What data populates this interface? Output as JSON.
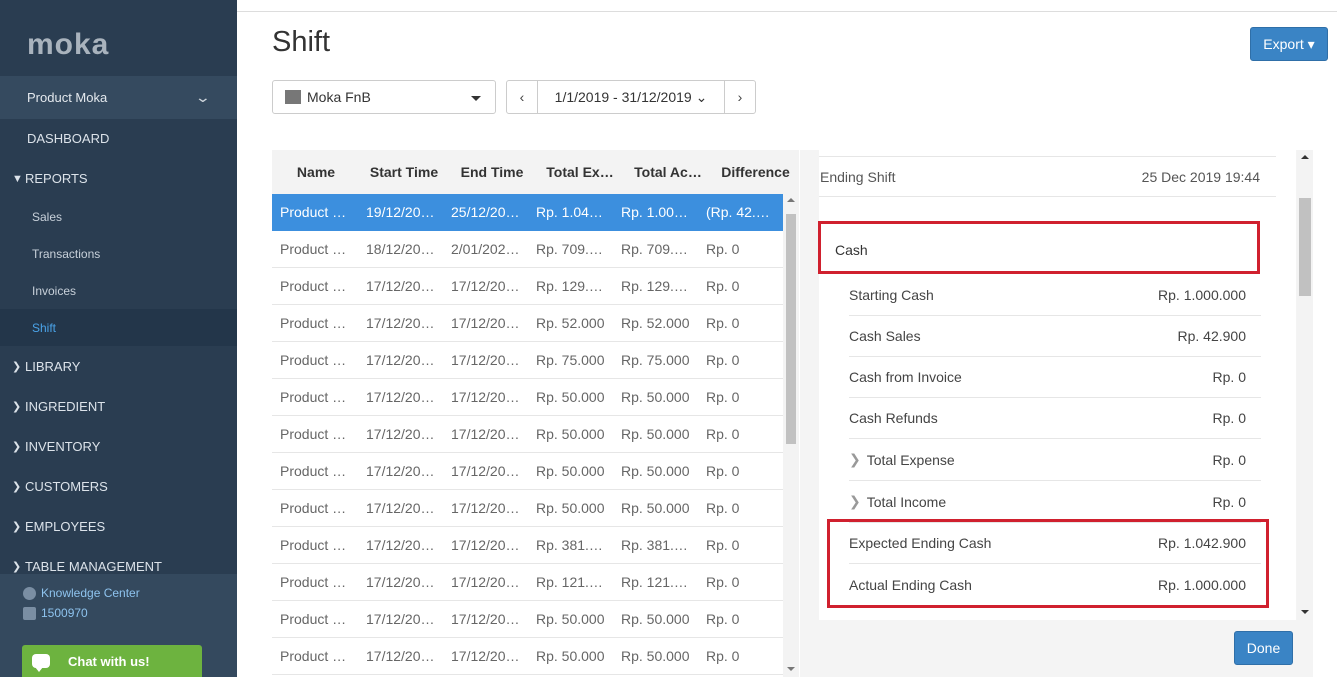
{
  "sidebar": {
    "logo": "moka",
    "product": "Product Moka",
    "dashboard": "DASHBOARD",
    "reports": "REPORTS",
    "report_items": [
      "Sales",
      "Transactions",
      "Invoices",
      "Shift"
    ],
    "sections": [
      "LIBRARY",
      "INGREDIENT",
      "INVENTORY",
      "CUSTOMERS",
      "EMPLOYEES",
      "TABLE MANAGEMENT"
    ],
    "knowledge_center": "Knowledge Center",
    "phone": "1500970",
    "chat": "Chat with us!"
  },
  "header": {
    "title": "Shift",
    "export": "Export ▾",
    "outlet": "Moka FnB",
    "date_range": "1/1/2019 - 31/12/2019 ⌄",
    "prev": "‹",
    "next": "›"
  },
  "table": {
    "columns": [
      "Name",
      "Start Time",
      "End Time",
      "Total Ex…",
      "Total Ac…",
      "Difference"
    ],
    "rows": [
      [
        "Product …",
        "19/12/20…",
        "25/12/20…",
        "Rp. 1.04…",
        "Rp. 1.00…",
        "(Rp. 42.…"
      ],
      [
        "Product …",
        "18/12/20…",
        "2/01/202…",
        "Rp. 709.…",
        "Rp. 709.…",
        "Rp. 0"
      ],
      [
        "Product …",
        "17/12/20…",
        "17/12/20…",
        "Rp. 129.…",
        "Rp. 129.…",
        "Rp. 0"
      ],
      [
        "Product …",
        "17/12/20…",
        "17/12/20…",
        "Rp. 52.000",
        "Rp. 52.000",
        "Rp. 0"
      ],
      [
        "Product …",
        "17/12/20…",
        "17/12/20…",
        "Rp. 75.000",
        "Rp. 75.000",
        "Rp. 0"
      ],
      [
        "Product …",
        "17/12/20…",
        "17/12/20…",
        "Rp. 50.000",
        "Rp. 50.000",
        "Rp. 0"
      ],
      [
        "Product …",
        "17/12/20…",
        "17/12/20…",
        "Rp. 50.000",
        "Rp. 50.000",
        "Rp. 0"
      ],
      [
        "Product …",
        "17/12/20…",
        "17/12/20…",
        "Rp. 50.000",
        "Rp. 50.000",
        "Rp. 0"
      ],
      [
        "Product …",
        "17/12/20…",
        "17/12/20…",
        "Rp. 50.000",
        "Rp. 50.000",
        "Rp. 0"
      ],
      [
        "Product …",
        "17/12/20…",
        "17/12/20…",
        "Rp. 381.…",
        "Rp. 381.…",
        "Rp. 0"
      ],
      [
        "Product …",
        "17/12/20…",
        "17/12/20…",
        "Rp. 121.…",
        "Rp. 121.…",
        "Rp. 0"
      ],
      [
        "Product …",
        "17/12/20…",
        "17/12/20…",
        "Rp. 50.000",
        "Rp. 50.000",
        "Rp. 0"
      ],
      [
        "Product …",
        "17/12/20…",
        "17/12/20…",
        "Rp. 50.000",
        "Rp. 50.000",
        "Rp. 0"
      ]
    ]
  },
  "detail": {
    "ending_label": "Ending Shift",
    "ending_value": "25 Dec 2019 19:44",
    "cash_heading": "Cash",
    "rows": [
      {
        "label": "Starting Cash",
        "value": "Rp. 1.000.000"
      },
      {
        "label": "Cash Sales",
        "value": "Rp. 42.900"
      },
      {
        "label": "Cash from Invoice",
        "value": "Rp. 0"
      },
      {
        "label": "Cash Refunds",
        "value": "Rp. 0"
      },
      {
        "label": "Total Expense",
        "value": "Rp. 0"
      },
      {
        "label": "Total Income",
        "value": "Rp. 0"
      },
      {
        "label": "Expected Ending Cash",
        "value": "Rp. 1.042.900"
      },
      {
        "label": "Actual Ending Cash",
        "value": "Rp. 1.000.000"
      }
    ],
    "done": "Done"
  },
  "colors": {
    "sidebar_bg": "#2a3d51",
    "accent": "#3a84c5",
    "row_selected": "#3c8fde",
    "highlight_box": "#d0202e",
    "chat_green": "#6db33f"
  }
}
